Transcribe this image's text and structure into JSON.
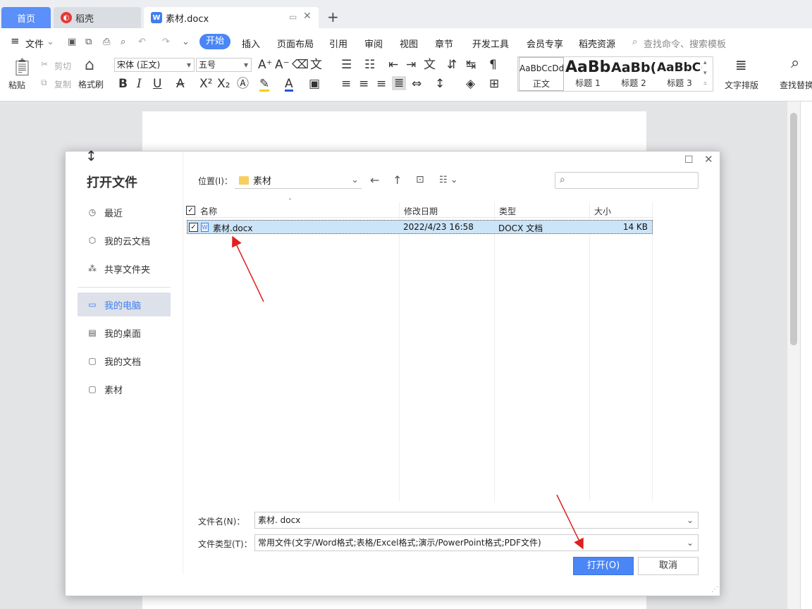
{
  "tabs": [
    {
      "label": "首页"
    },
    {
      "label": "稻壳"
    },
    {
      "label": "素材.docx"
    }
  ],
  "new_tab": "+",
  "menu": {
    "file": "文件",
    "items": [
      "开始",
      "插入",
      "页面布局",
      "引用",
      "审阅",
      "视图",
      "章节",
      "开发工具",
      "会员专享",
      "稻壳资源"
    ],
    "search_placeholder": "查找命令、搜索模板"
  },
  "toolbar": {
    "paste": "粘贴",
    "cut": "剪切",
    "copy": "复制",
    "format_painter": "格式刷",
    "font_name": "宋体 (正文)",
    "font_size": "五号",
    "styles": [
      {
        "preview": "AaBbCcDd",
        "label": "正文"
      },
      {
        "preview": "AaBb",
        "label": "标题 1"
      },
      {
        "preview": "AaBb(",
        "label": "标题 2"
      },
      {
        "preview": "AaBbC(",
        "label": "标题 3"
      }
    ],
    "text_layout": "文字排版",
    "find_replace": "查找替换"
  },
  "dialog": {
    "title": "打开文件",
    "location_label": "位置(I)：",
    "location_value": "素材",
    "nav": [
      {
        "label": "最近",
        "icon": "clock-icon"
      },
      {
        "label": "我的云文档",
        "icon": "cloud-doc-icon"
      },
      {
        "label": "共享文件夹",
        "icon": "share-icon"
      },
      {
        "label": "我的电脑",
        "icon": "computer-icon"
      },
      {
        "label": "我的桌面",
        "icon": "desktop-icon"
      },
      {
        "label": "我的文档",
        "icon": "documents-icon"
      },
      {
        "label": "素材",
        "icon": "folder-icon"
      }
    ],
    "columns": {
      "name": "名称",
      "modified": "修改日期",
      "type": "类型",
      "size": "大小"
    },
    "files": [
      {
        "name": "素材.docx",
        "modified": "2022/4/23 16:58",
        "type": "DOCX 文档",
        "size": "14 KB"
      }
    ],
    "filename_label": "文件名(N)：",
    "filename_value": "素材. docx",
    "filetype_label": "文件类型(T)：",
    "filetype_value": "常用文件(文字/Word格式;表格/Excel格式;演示/PowerPoint格式;PDF文件)",
    "open_button": "打开(O)",
    "cancel_button": "取消"
  },
  "colors": {
    "accent": "#4a86f5",
    "selection": "#cce4f7",
    "annotation_arrow": "#e02020"
  }
}
